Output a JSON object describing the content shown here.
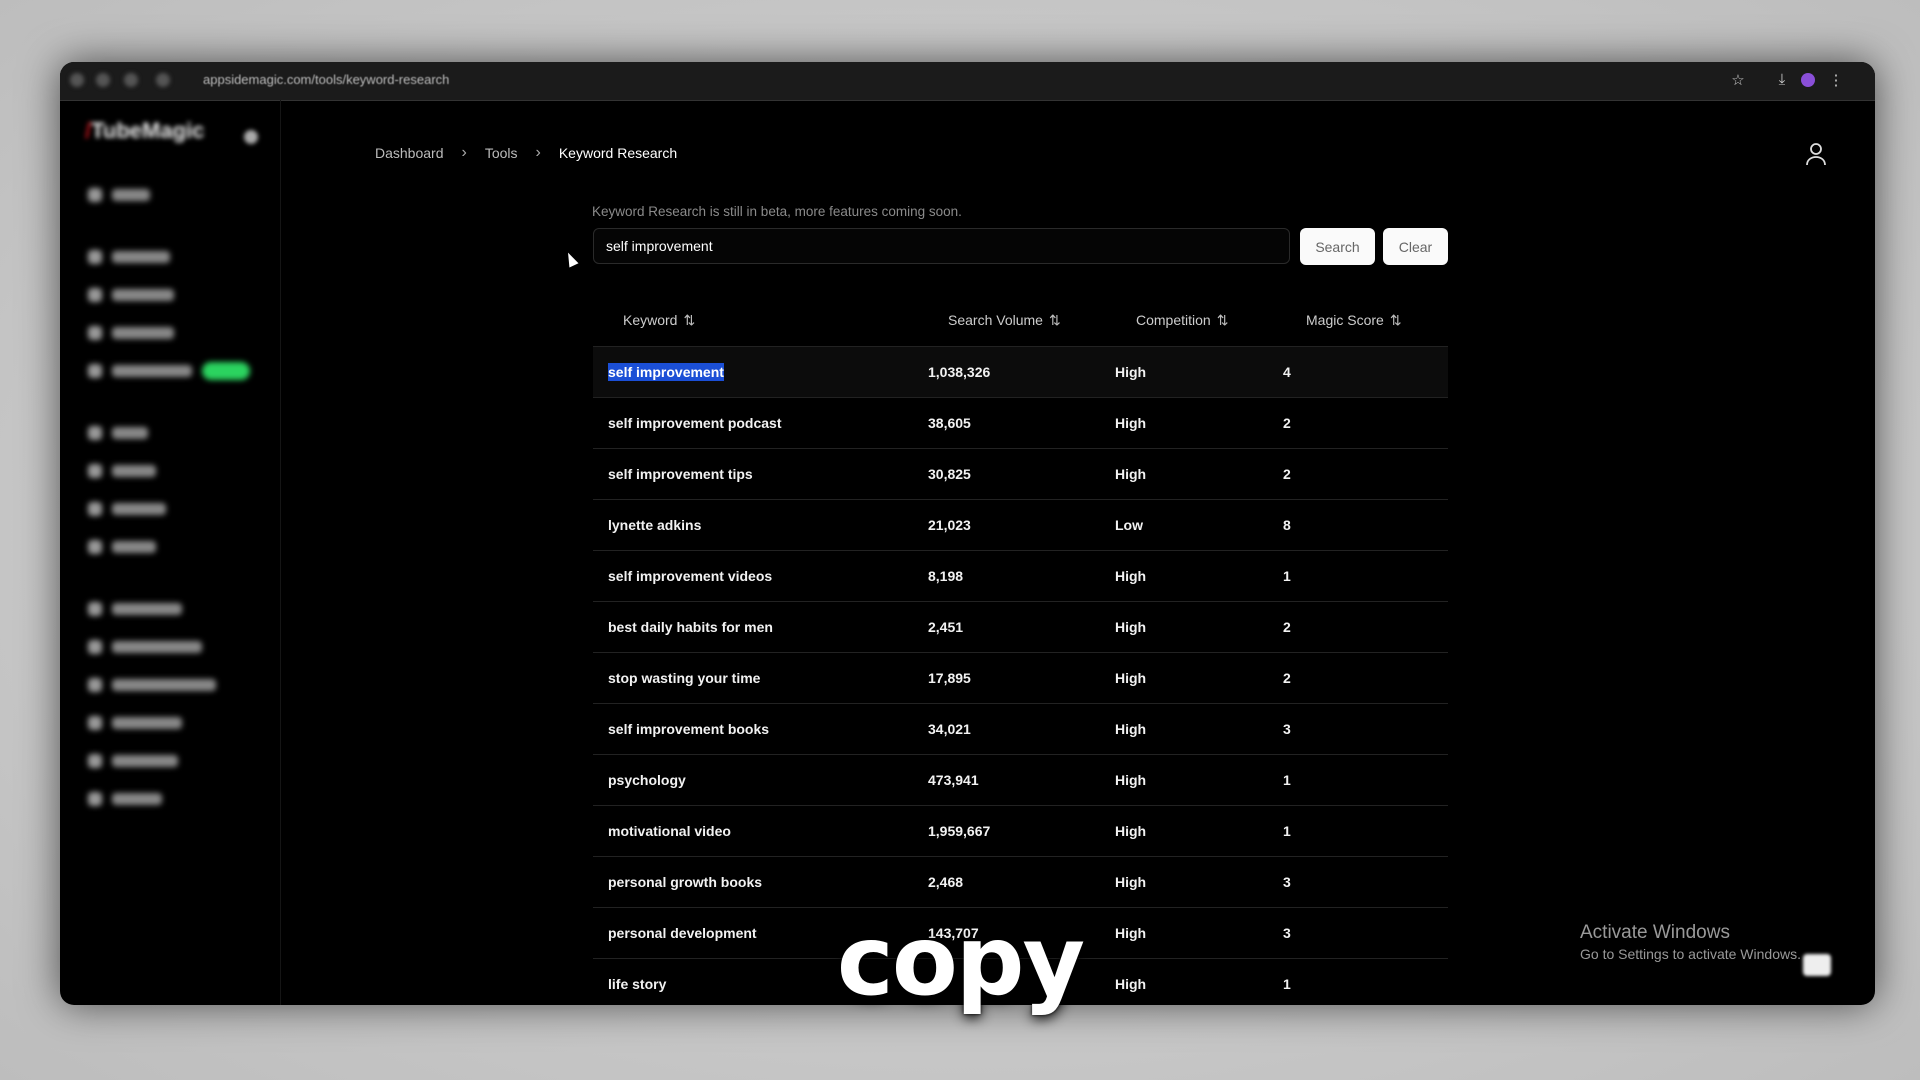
{
  "browser": {
    "url": "appsidemagic.com/tools/keyword-research",
    "icons": [
      "back-icon",
      "forward-icon",
      "reload-icon",
      "site-info-icon",
      "star-icon",
      "download-icon",
      "profile-icon",
      "menu-icon"
    ]
  },
  "sidebar": {
    "logo": "TubeMagic",
    "new_badge_color": "#2bd35f"
  },
  "breadcrumb": [
    "Dashboard",
    "Tools",
    "Keyword Research"
  ],
  "beta_notice": "Keyword Research is still in beta, more features coming soon.",
  "search": {
    "value": "self improvement",
    "search_label": "Search",
    "clear_label": "Clear"
  },
  "table": {
    "columns": [
      "Keyword",
      "Search Volume",
      "Competition",
      "Magic Score"
    ],
    "rows": [
      {
        "keyword": "self improvement",
        "volume": "1,038,326",
        "competition": "High",
        "score": "4"
      },
      {
        "keyword": "self improvement podcast",
        "volume": "38,605",
        "competition": "High",
        "score": "2"
      },
      {
        "keyword": "self improvement tips",
        "volume": "30,825",
        "competition": "High",
        "score": "2"
      },
      {
        "keyword": "lynette adkins",
        "volume": "21,023",
        "competition": "Low",
        "score": "8"
      },
      {
        "keyword": "self improvement videos",
        "volume": "8,198",
        "competition": "High",
        "score": "1"
      },
      {
        "keyword": "best daily habits for men",
        "volume": "2,451",
        "competition": "High",
        "score": "2"
      },
      {
        "keyword": "stop wasting your time",
        "volume": "17,895",
        "competition": "High",
        "score": "2"
      },
      {
        "keyword": "self improvement books",
        "volume": "34,021",
        "competition": "High",
        "score": "3"
      },
      {
        "keyword": "psychology",
        "volume": "473,941",
        "competition": "High",
        "score": "1"
      },
      {
        "keyword": "motivational video",
        "volume": "1,959,667",
        "competition": "High",
        "score": "1"
      },
      {
        "keyword": "personal growth books",
        "volume": "2,468",
        "competition": "High",
        "score": "3"
      },
      {
        "keyword": "personal development",
        "volume": "143,707",
        "competition": "High",
        "score": "3"
      },
      {
        "keyword": "life story",
        "volume": "",
        "competition": "High",
        "score": "1"
      }
    ]
  },
  "watermark": {
    "title": "Activate Windows",
    "subtitle": "Go to Settings to activate Windows."
  },
  "caption": "copy"
}
